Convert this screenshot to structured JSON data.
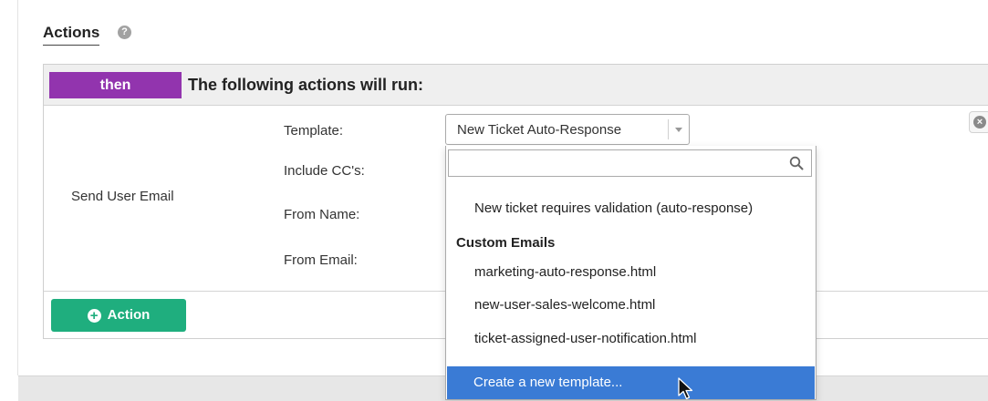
{
  "section": {
    "title": "Actions",
    "help_glyph": "?"
  },
  "panel": {
    "then_label": "then",
    "header_text": "The following actions will run:",
    "action_name": "Send User Email",
    "fields": {
      "template": "Template:",
      "include_cc": "Include CC's:",
      "from_name": "From Name:",
      "from_email": "From Email:"
    },
    "remove_glyph": "×",
    "add_action_label": "Action"
  },
  "template_select": {
    "value": "New Ticket Auto-Response",
    "search_value": "",
    "items": [
      {
        "type": "option",
        "label": "New ticket requires validation (auto-response)"
      },
      {
        "type": "group",
        "label": "Custom Emails"
      },
      {
        "type": "option",
        "label": "marketing-auto-response.html"
      },
      {
        "type": "option",
        "label": "new-user-sales-welcome.html"
      },
      {
        "type": "option",
        "label": "ticket-assigned-user-notification.html"
      }
    ],
    "create_label": "Create a new template..."
  },
  "colors": {
    "then_badge": "#9234ae",
    "add_button": "#1fae7e",
    "highlight": "#3a7bd5"
  }
}
